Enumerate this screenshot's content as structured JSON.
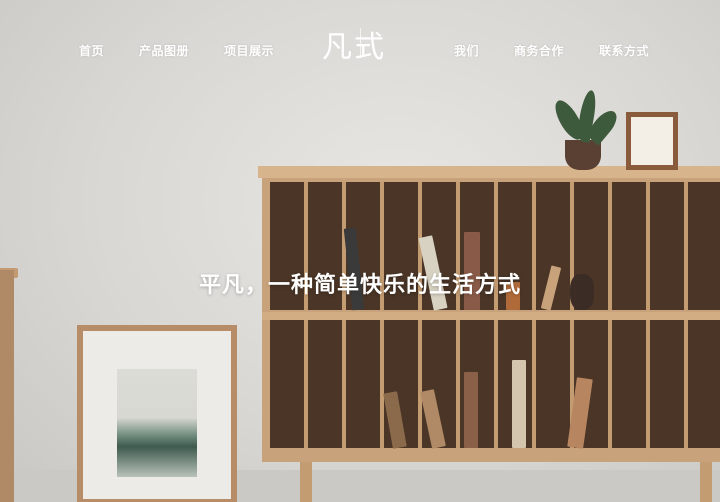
{
  "nav": {
    "left_items": [
      {
        "label": "首页"
      },
      {
        "label": "产品图册"
      },
      {
        "label": "项目展示"
      }
    ],
    "right_items": [
      {
        "label": "我们"
      },
      {
        "label": "商务合作"
      },
      {
        "label": "联系方式"
      }
    ],
    "logo_text": "凡式"
  },
  "hero": {
    "headline": "平凡，一种简单快乐的生活方式"
  }
}
